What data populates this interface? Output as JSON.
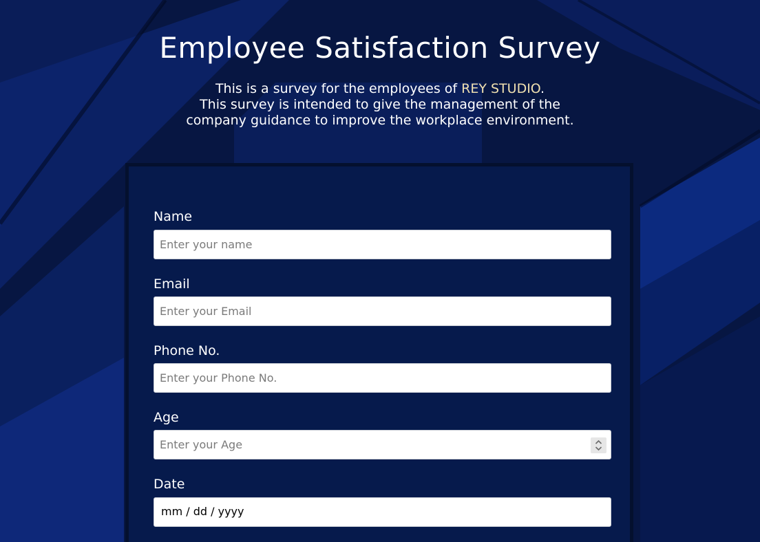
{
  "header": {
    "title": "Employee Satisfaction Survey",
    "description_prefix": "This is a survey for the employees of ",
    "company": "REY STUDIO",
    "description_suffix": ".",
    "description_line2": "This survey is intended to give the management of the company guidance to improve the workplace environment."
  },
  "form": {
    "name": {
      "label": "Name",
      "placeholder": "Enter your name"
    },
    "email": {
      "label": "Email",
      "placeholder": "Enter your Email"
    },
    "phone": {
      "label": "Phone No.",
      "placeholder": "Enter your Phone No."
    },
    "age": {
      "label": "Age",
      "placeholder": "Enter your Age"
    },
    "date": {
      "label": "Date",
      "display": "mm / dd / yyyy"
    }
  },
  "colors": {
    "background": "#071642",
    "card": "#061a4c",
    "brand_accent": "#f0e0b0",
    "text": "#ffffff"
  },
  "icons": {
    "age_spinner": "spinner-arrows-icon"
  }
}
